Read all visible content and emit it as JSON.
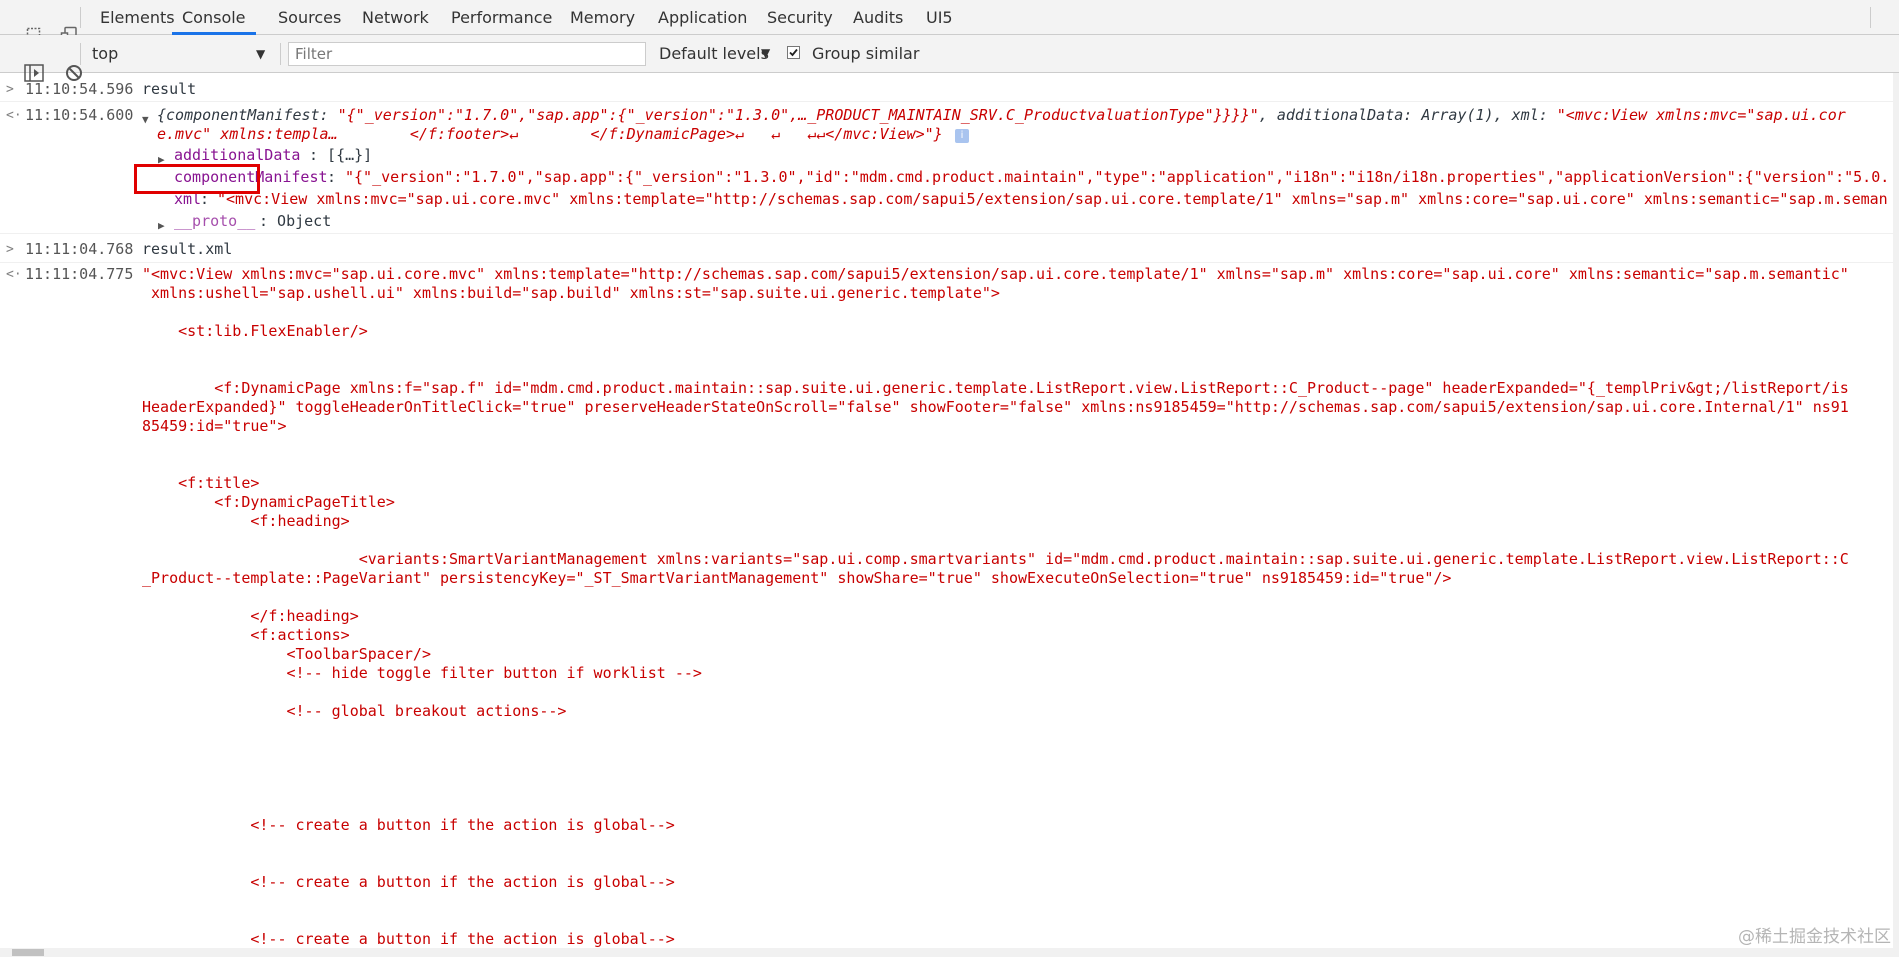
{
  "tabs": [
    "Elements",
    "Console",
    "Sources",
    "Network",
    "Performance",
    "Memory",
    "Application",
    "Security",
    "Audits",
    "UI5"
  ],
  "toolbar": {
    "context": "top",
    "filter_placeholder": "Filter",
    "levels": "Default levels",
    "group_similar": "Group similar",
    "group_similar_checked": true
  },
  "log": {
    "in1": {
      "ts": "11:10:54.596",
      "cmd": "result"
    },
    "out1": {
      "ts": "11:10:54.600",
      "summary_l1_a": "{componentManifest: ",
      "summary_l1_b": "\"{\"_version\":\"1.7.0\",\"sap.app\":{\"_version\":\"1.3.0\",…_PRODUCT_MAINTAIN_SRV.C_ProductvaluationType\"}}}}\"",
      "summary_l1_c": ", additionalData: Array(1), xml: ",
      "summary_l1_d": "\"<mvc:View xmlns:mvc=\"sap.ui.cor",
      "summary_l2": "e.mvc\" xmlns:templa…        </f:footer>↵        </f:DynamicPage>↵   ↵   ↵↵</mvc:View>\"}",
      "prop1_key": "additionalData",
      "prop1_val": ": [{…}]",
      "prop2_key": "componentManifest",
      "prop2_val": "\"{\"_version\":\"1.7.0\",\"sap.app\":{\"_version\":\"1.3.0\",\"id\":\"mdm.cmd.product.maintain\",\"type\":\"application\",\"i18n\":\"i18n/i18n.properties\",\"applicationVersion\":{\"version\":\"5.0.",
      "prop3_key": "xml",
      "prop3_val": "\"<mvc:View xmlns:mvc=\"sap.ui.core.mvc\" xmlns:template=\"http://schemas.sap.com/sapui5/extension/sap.ui.core.template/1\" xmlns=\"sap.m\" xmlns:core=\"sap.ui.core\" xmlns:semantic=\"sap.m.seman",
      "prop4_key": "__proto__",
      "prop4_val": ": Object"
    },
    "in2": {
      "ts": "11:11:04.768",
      "cmd": "result.xml"
    },
    "out2": {
      "ts": "11:11:04.775",
      "lines": [
        "\"<mvc:View xmlns:mvc=\"sap.ui.core.mvc\" xmlns:template=\"http://schemas.sap.com/sapui5/extension/sap.ui.core.template/1\" xmlns=\"sap.m\" xmlns:core=\"sap.ui.core\" xmlns:semantic=\"sap.m.semantic\"",
        " xmlns:ushell=\"sap.ushell.ui\" xmlns:build=\"sap.build\" xmlns:st=\"sap.suite.ui.generic.template\">",
        "    <st:lib.FlexEnabler/>",
        "        <f:DynamicPage xmlns:f=\"sap.f\" id=\"mdm.cmd.product.maintain::sap.suite.ui.generic.template.ListReport.view.ListReport::C_Product--page\" headerExpanded=\"{_templPriv&gt;/listReport/is",
        "HeaderExpanded}\" toggleHeaderOnTitleClick=\"true\" preserveHeaderStateOnScroll=\"false\" showFooter=\"false\" xmlns:ns9185459=\"http://schemas.sap.com/sapui5/extension/sap.ui.core.Internal/1\" ns91",
        "85459:id=\"true\">",
        "    <f:title>",
        "        <f:DynamicPageTitle>",
        "            <f:heading>",
        "                        <variants:SmartVariantManagement xmlns:variants=\"sap.ui.comp.smartvariants\" id=\"mdm.cmd.product.maintain::sap.suite.ui.generic.template.ListReport.view.ListReport::C",
        "_Product--template::PageVariant\" persistencyKey=\"_ST_SmartVariantManagement\" showShare=\"true\" showExecuteOnSelection=\"true\" ns9185459:id=\"true\"/>",
        "            </f:heading>",
        "            <f:actions>",
        "                <ToolbarSpacer/>",
        "                <!-- hide toggle filter button if worklist -->",
        "                <!-- global breakout actions-->",
        "            <!-- create a button if the action is global-->",
        "            <!-- create a button if the action is global-->",
        "            <!-- create a button if the action is global-->"
      ]
    }
  },
  "watermark": "@稀土掘金技术社区"
}
